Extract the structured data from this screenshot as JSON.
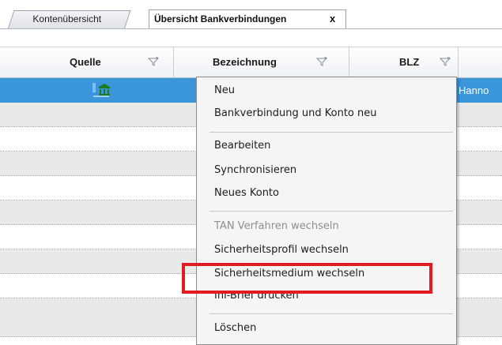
{
  "tabs": [
    {
      "label": "Kontenübersicht",
      "active": false
    },
    {
      "label": "Übersicht Bankverbindungen",
      "active": true,
      "close_glyph": "x"
    }
  ],
  "grid": {
    "columns": [
      {
        "label": "Quelle",
        "filter_icon": "filter-icon"
      },
      {
        "label": "Bezeichnung",
        "filter_icon": "filter-icon"
      },
      {
        "label": "BLZ",
        "filter_icon": "filter-icon"
      }
    ],
    "selected_row": {
      "source_icon": "bank-building-icon",
      "location_text": "Hanno"
    }
  },
  "context_menu": {
    "groups": [
      [
        {
          "label": "Neu",
          "enabled": true
        },
        {
          "label": "Bankverbindung und Konto neu",
          "enabled": true
        }
      ],
      [
        {
          "label": "Bearbeiten",
          "enabled": true
        },
        {
          "label": "Synchronisieren",
          "enabled": true
        },
        {
          "label": "Neues Konto",
          "enabled": true
        }
      ],
      [
        {
          "label": "TAN Verfahren wechseln",
          "enabled": false
        },
        {
          "label": "Sicherheitsprofil wechseln",
          "enabled": true
        },
        {
          "label": "Sicherheitsmedium wechseln",
          "enabled": true,
          "highlighted": true
        },
        {
          "label": "Ini-Brief drucken",
          "enabled": true
        }
      ],
      [
        {
          "label": "Löschen",
          "enabled": true
        }
      ]
    ]
  },
  "colors": {
    "selection": "#3b95da",
    "highlight_frame": "#e11b22",
    "alt_row": "#e9e9e9"
  }
}
